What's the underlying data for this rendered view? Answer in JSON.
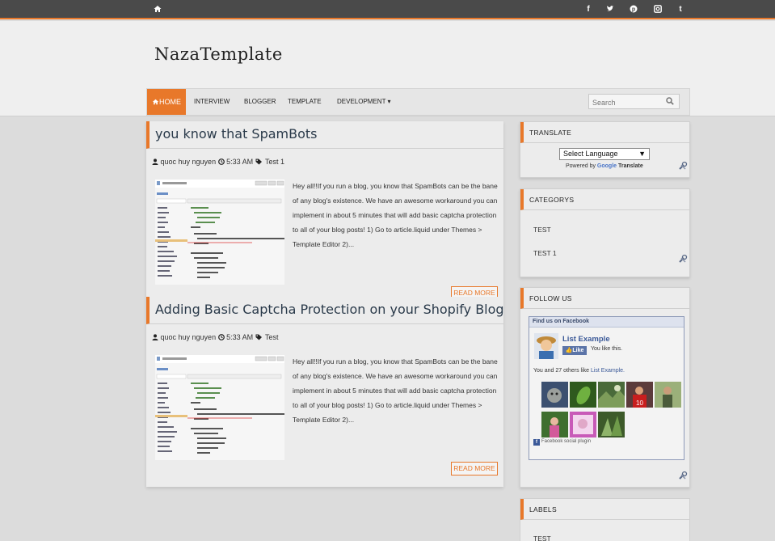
{
  "topbar": {
    "left_icon": "home-icon",
    "social": [
      {
        "name": "facebook-icon",
        "glyph": "f"
      },
      {
        "name": "twitter-icon",
        "glyph": "t"
      },
      {
        "name": "pinterest-icon",
        "glyph": "p"
      },
      {
        "name": "instagram-icon",
        "glyph": "◘"
      },
      {
        "name": "tumblr-icon",
        "glyph": "t"
      }
    ],
    "accent": "#e8782a"
  },
  "header": {
    "site_title": "NazaTemplate"
  },
  "nav": {
    "home": "HOME",
    "items": [
      "INTERVIEW",
      "BLOGGER",
      "TEMPLATE",
      "DEVELOPMENT"
    ],
    "dropdown_indicator": "▾",
    "search_placeholder": "Search"
  },
  "posts": [
    {
      "title": "you know that SpamBots",
      "author": "quoc huy nguyen",
      "time": "5:33 AM",
      "label": "Test 1",
      "snippet": "Hey all!!If you run a blog, you know that SpamBots can be the bane of any blog's existence. We have an awesome workaround you can implement in about 5 minutes that will add basic captcha protection to all of your blog posts! 1) Go to article.liquid under Themes > Template Editor 2)...",
      "read_more": "READ MORE"
    },
    {
      "title": "Adding Basic Captcha Protection on your Shopify Blog",
      "author": "quoc huy nguyen",
      "time": "5:33 AM",
      "label": "Test",
      "snippet": "Hey all!!If you run a blog, you know that SpamBots can be the bane of any blog's existence. We have an awesome workaround you can implement in about 5 minutes that will add basic captcha protection to all of your blog posts! 1) Go to article.liquid under Themes > Template Editor 2)...",
      "read_more": "READ MORE"
    }
  ],
  "sidebar": {
    "translate": {
      "title": "TRANSLATE",
      "select_value": "Select Language",
      "powered_by": "Powered by",
      "google": "Google",
      "translate_word": "Translate"
    },
    "categories": {
      "title": "CATEGORYS",
      "items": [
        "TEST",
        "TEST 1"
      ]
    },
    "follow": {
      "title": "FOLLOW US",
      "fb_header": "Find us on Facebook",
      "page_name": "List Example",
      "like_button": "Like",
      "you_like": "You like this.",
      "count_text": "You and 27 others like",
      "count_link": "List Example.",
      "plugin_text": "Facebook social plugin",
      "fb_color": "#3b5998"
    },
    "labels": {
      "title": "LABELS",
      "first_item": "TEST"
    }
  }
}
